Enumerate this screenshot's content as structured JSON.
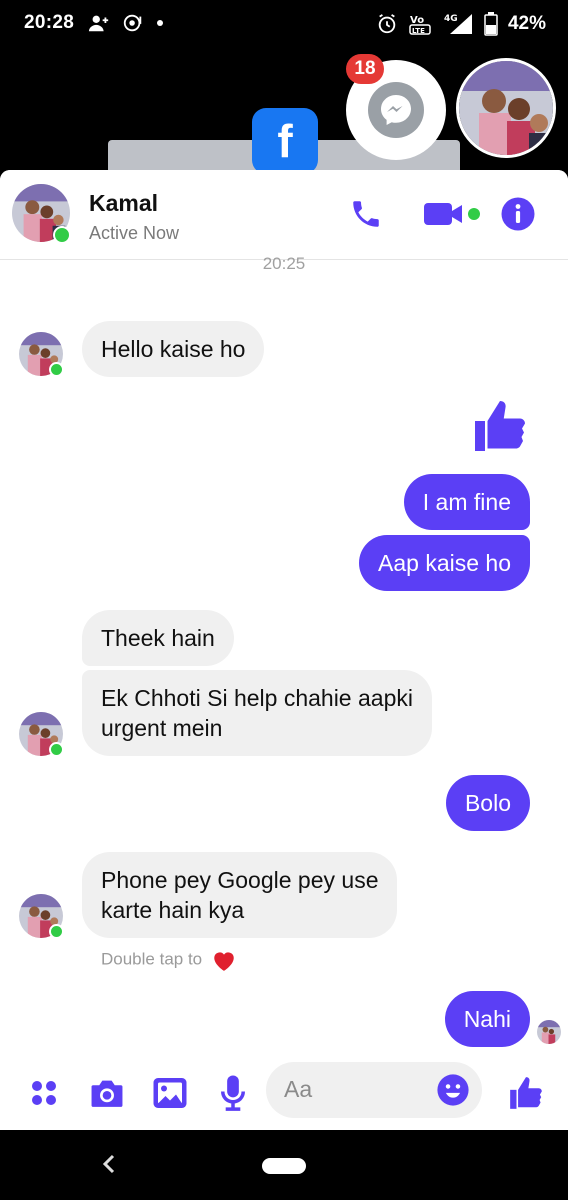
{
  "status_bar": {
    "time": "20:28",
    "battery": "42%",
    "network": "4G"
  },
  "chat_head": {
    "badge_count": "18"
  },
  "header": {
    "name": "Kamal",
    "status": "Active Now"
  },
  "conversation": {
    "timestamp": "20:25",
    "messages": [
      {
        "from": "them",
        "text": "Hello kaise ho"
      },
      {
        "from": "me",
        "type": "like"
      },
      {
        "from": "me",
        "text": "I am fine"
      },
      {
        "from": "me",
        "text": "Aap kaise ho"
      },
      {
        "from": "them",
        "text": "Theek hain"
      },
      {
        "from": "them",
        "lines": [
          "Ek Chhoti Si help chahie aapki",
          "urgent mein"
        ]
      },
      {
        "from": "me",
        "text": "Bolo"
      },
      {
        "from": "them",
        "lines": [
          "Phone pey Google pey use",
          "karte hain kya"
        ]
      },
      {
        "from": "me",
        "text": "Nahi"
      }
    ],
    "reaction_hint": "Double tap to"
  },
  "composer": {
    "placeholder": "Aa"
  },
  "colors": {
    "accent": "#5b3ff5",
    "incoming_bubble": "#f0f0f0",
    "online": "#31cc46",
    "badge": "#e53935"
  },
  "icons": [
    "menu-dots-icon",
    "camera-icon",
    "gallery-icon",
    "microphone-icon",
    "emoji-icon",
    "thumbs-up-icon",
    "phone-icon",
    "video-icon",
    "info-icon",
    "heart-icon",
    "messenger-icon",
    "back-icon"
  ]
}
